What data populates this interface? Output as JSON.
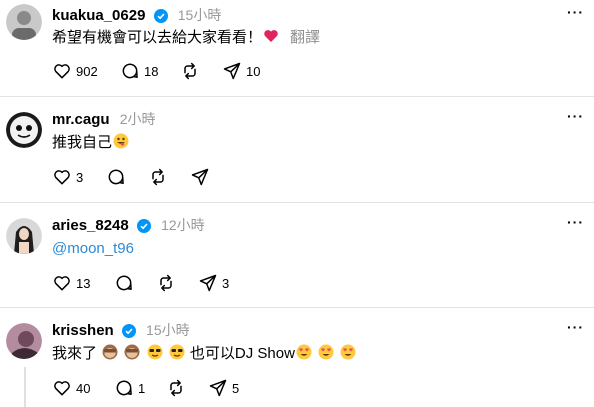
{
  "posts": [
    {
      "username": "kuakua_0629",
      "verified": true,
      "time": "15小時",
      "text": "希望有機會可以去給大家看看！",
      "translate": "翻譯",
      "likes": "902",
      "comments": "18",
      "shares": "10"
    },
    {
      "username": "mr.cagu",
      "verified": false,
      "time": "2小時",
      "text": "推我自己",
      "likes": "3"
    },
    {
      "username": "aries_8248",
      "verified": true,
      "time": "12小時",
      "mention": "@moon_t96",
      "likes": "13",
      "shares": "3"
    },
    {
      "username": "krisshen",
      "verified": true,
      "time": "15小時",
      "text_a": "我來了",
      "text_b": "也可以DJ Show",
      "likes": "40",
      "comments": "1",
      "shares": "5"
    }
  ],
  "more_glyph": "···"
}
